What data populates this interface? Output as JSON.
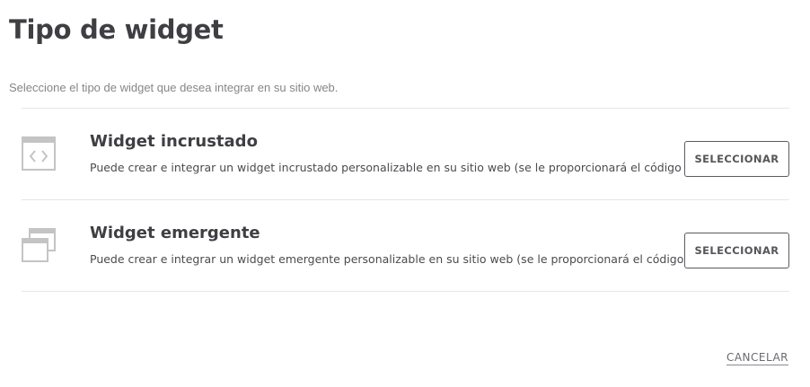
{
  "header": {
    "title": "Tipo de widget",
    "subtitle": "Seleccione el tipo de widget que desea integrar en su sitio web."
  },
  "options": [
    {
      "icon": "embedded-code-window-icon",
      "title": "Widget incrustado",
      "description": "Puede crear e integrar un widget incrustado personalizable en su sitio web (se le proporcionará el código HTML)",
      "button_label": "SELECCIONAR"
    },
    {
      "icon": "popup-stacked-windows-icon",
      "title": "Widget emergente",
      "description": "Puede crear e integrar un widget emergente personalizable en su sitio web (se le proporcionará el código HTML)",
      "button_label": "SELECCIONAR"
    }
  ],
  "footer": {
    "cancel_label": "CANCELAR"
  },
  "colors": {
    "text_dark": "#3f3f43",
    "text_muted": "#86868a",
    "icon_gray": "#c4c4c4",
    "divider": "#e6e6e6",
    "button_border": "#5c5c60"
  }
}
